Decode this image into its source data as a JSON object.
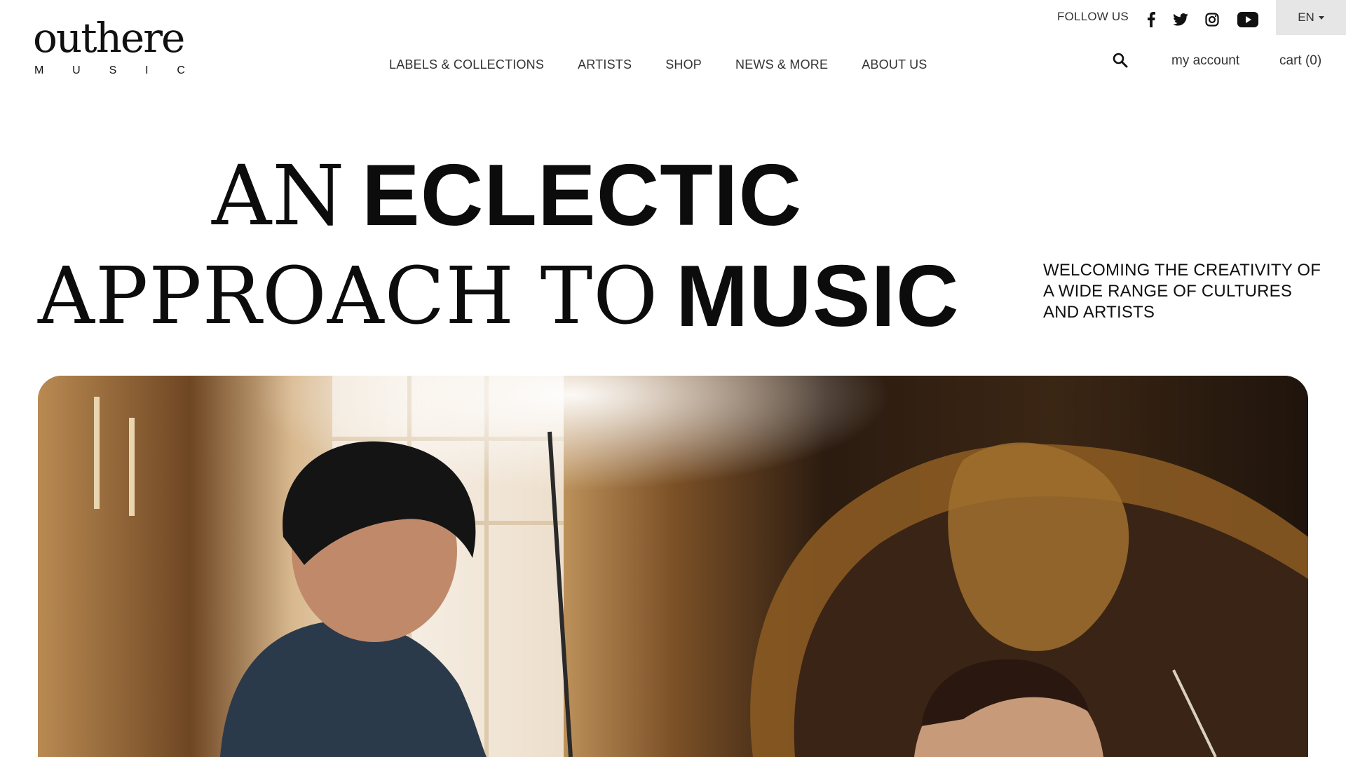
{
  "brand": {
    "logo_word": "outhere",
    "logo_sub": [
      "M",
      "U",
      "S",
      "I",
      "C"
    ]
  },
  "nav": {
    "items": [
      {
        "label": "LABELS & COLLECTIONS"
      },
      {
        "label": "ARTISTS"
      },
      {
        "label": "SHOP"
      },
      {
        "label": "NEWS & MORE"
      },
      {
        "label": "ABOUT US"
      }
    ]
  },
  "utility": {
    "follow_label": "FOLLOW US",
    "social_icons": [
      "facebook-icon",
      "twitter-icon",
      "instagram-icon",
      "youtube-icon"
    ],
    "language": "EN",
    "account_label": "my account",
    "cart_label": "cart (0)"
  },
  "hero": {
    "headline_line1": {
      "serif": "AN",
      "sans": "ECLECTIC"
    },
    "headline_line2": {
      "serif": "APPROACH TO",
      "sans": "MUSIC"
    },
    "tagline": "WELCOMING THE CREATIVITY OF A WIDE RANGE OF CULTURES AND ARTISTS"
  },
  "colors": {
    "background": "#ffffff",
    "text": "#111111",
    "lang_bg": "#e6e6e6"
  }
}
